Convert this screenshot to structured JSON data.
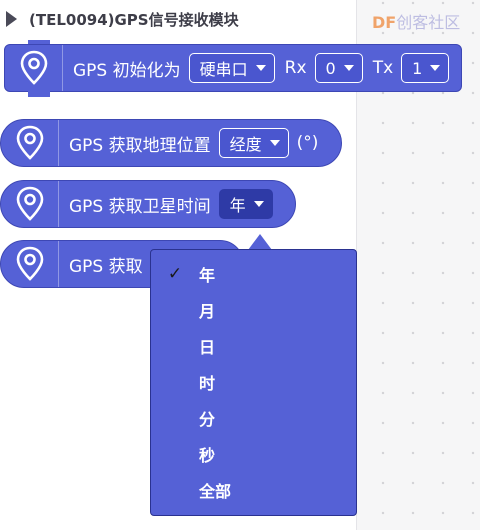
{
  "category": {
    "title": "(TEL0094)GPS信号接收模块"
  },
  "watermark": {
    "brand": "DF",
    "rest": "创客社区"
  },
  "blocks": {
    "init": {
      "label": "GPS 初始化为",
      "port": "硬串口",
      "rx_label": "Rx",
      "rx_value": "0",
      "tx_label": "Tx",
      "tx_value": "1"
    },
    "location": {
      "label": "GPS 获取地理位置",
      "value": "经度",
      "unit": "(°)"
    },
    "time": {
      "label": "GPS 获取卫星时间",
      "value": "年"
    },
    "get": {
      "label": "GPS 获取"
    }
  },
  "menu": {
    "checkmark": "✓",
    "items": [
      "年",
      "月",
      "日",
      "时",
      "分",
      "秒",
      "全部"
    ],
    "selected_index": 0
  },
  "colors": {
    "block": "#5561d6",
    "block_border": "#3d47b4",
    "menu_border": "#2a3290"
  }
}
